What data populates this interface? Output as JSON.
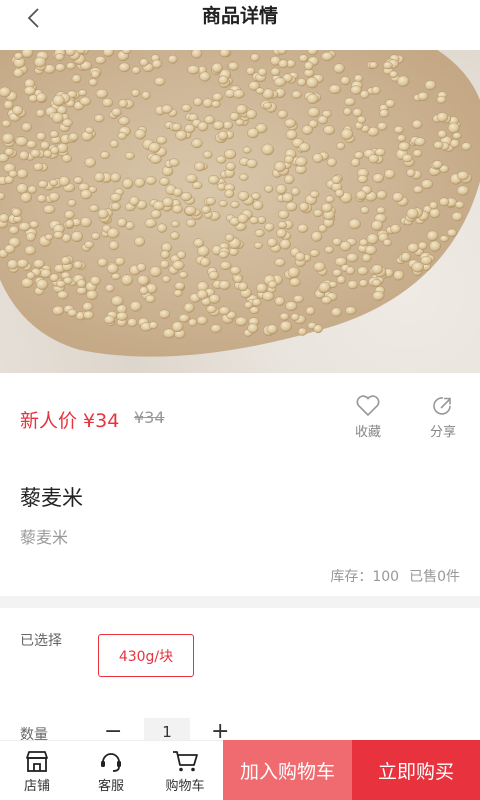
{
  "header": {
    "title": "商品详情"
  },
  "gallery": {
    "dots": 2,
    "active_dot": 0
  },
  "price": {
    "label": "新人价 ¥34",
    "original": "¥34"
  },
  "actions": {
    "favorite": "收藏",
    "share": "分享"
  },
  "product": {
    "name": "藜麦米",
    "subtitle": "藜麦米"
  },
  "stock": {
    "inventory": "库存：100",
    "sold": "已售0件"
  },
  "selection": {
    "label": "已选择",
    "option": "430g/块"
  },
  "quantity": {
    "label": "数量",
    "minus": "−",
    "value": "1",
    "plus": "+"
  },
  "bottom_bar": {
    "store": "店铺",
    "service": "客服",
    "cart": "购物车",
    "add_to_cart": "加入购物车",
    "buy_now": "立即购买"
  },
  "colors": {
    "accent": "#e8333e",
    "accent_light": "#f06b70",
    "muted": "#999999"
  }
}
